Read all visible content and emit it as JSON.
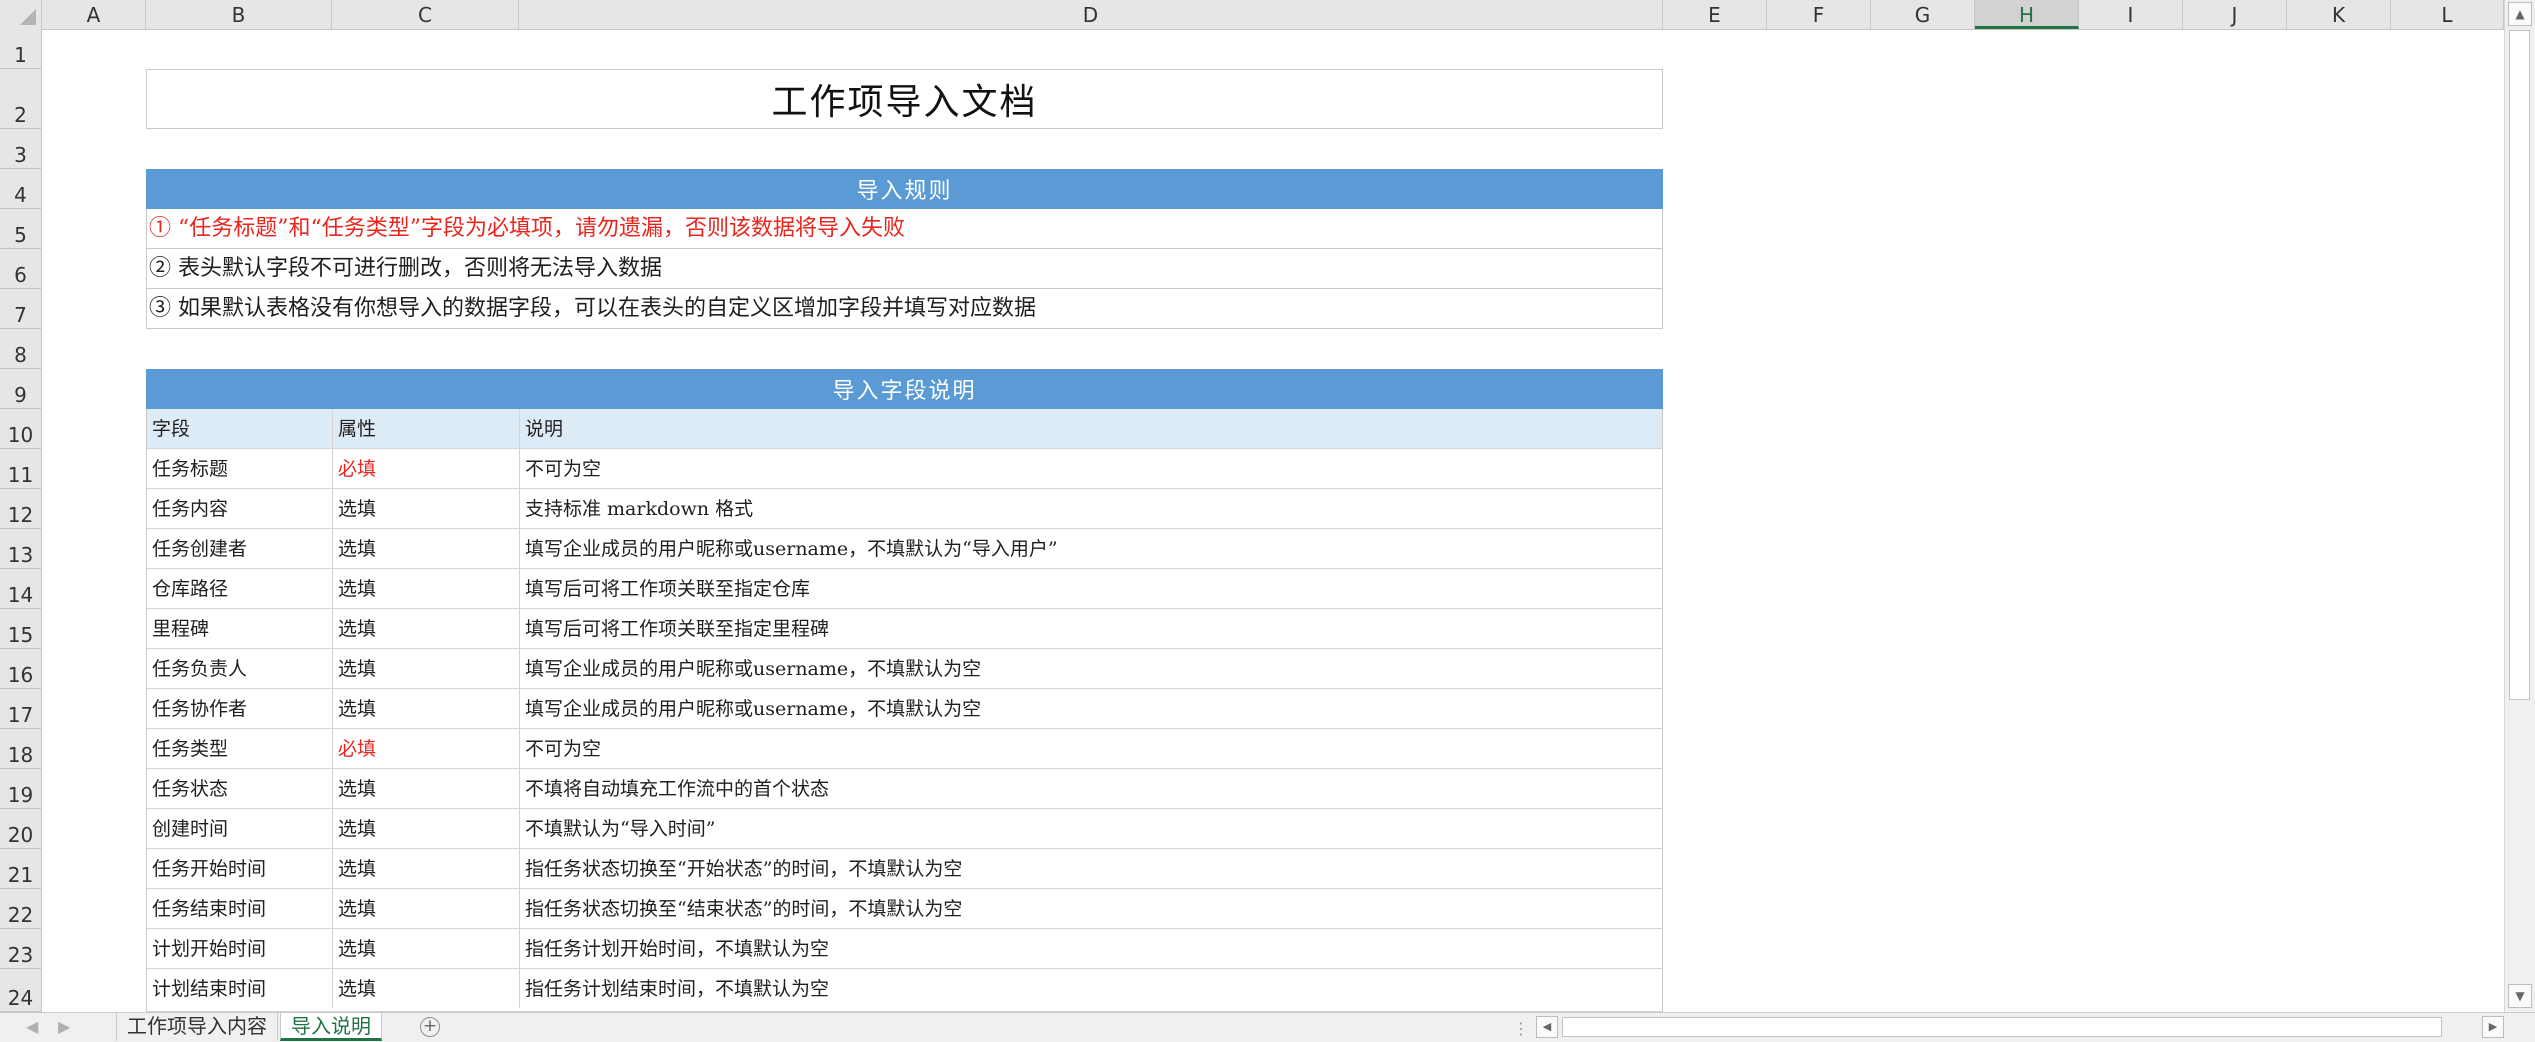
{
  "columns": [
    "A",
    "B",
    "C",
    "D",
    "E",
    "F",
    "G",
    "H",
    "I",
    "J",
    "K",
    "L"
  ],
  "selected_column": "H",
  "rows": [
    "1",
    "2",
    "3",
    "4",
    "5",
    "6",
    "7",
    "8",
    "9",
    "10",
    "11",
    "12",
    "13",
    "14",
    "15",
    "16",
    "17",
    "18",
    "19",
    "20",
    "21",
    "22",
    "23",
    "24"
  ],
  "sheet": {
    "title": "工作项导入文档",
    "rules_header": "导入规则",
    "rules": [
      "①  “任务标题”和“任务类型”字段为必填项，请勿遗漏，否则该数据将导入失败",
      "②  表头默认字段不可进行删改，否则将无法导入数据",
      "③  如果默认表格没有你想导入的数据字段，可以在表头的自定义区增加字段并填写对应数据"
    ],
    "fields_header": "导入字段说明",
    "table_header": [
      "字段",
      "属性",
      "说明"
    ],
    "fields": [
      {
        "name": "任务标题",
        "attr": "必填",
        "desc": "不可为空"
      },
      {
        "name": "任务内容",
        "attr": "选填",
        "desc": "支持标准 markdown 格式"
      },
      {
        "name": "任务创建者",
        "attr": "选填",
        "desc": "填写企业成员的用户昵称或username，不填默认为“导入用户”"
      },
      {
        "name": "仓库路径",
        "attr": "选填",
        "desc": "填写后可将工作项关联至指定仓库"
      },
      {
        "name": "里程碑",
        "attr": "选填",
        "desc": "填写后可将工作项关联至指定里程碑"
      },
      {
        "name": "任务负责人",
        "attr": "选填",
        "desc": "填写企业成员的用户昵称或username，不填默认为空"
      },
      {
        "name": "任务协作者",
        "attr": "选填",
        "desc": "填写企业成员的用户昵称或username，不填默认为空"
      },
      {
        "name": "任务类型",
        "attr": "必填",
        "desc": "不可为空"
      },
      {
        "name": "任务状态",
        "attr": "选填",
        "desc": "不填将自动填充工作流中的首个状态"
      },
      {
        "name": "创建时间",
        "attr": "选填",
        "desc": "不填默认为“导入时间”"
      },
      {
        "name": "任务开始时间",
        "attr": "选填",
        "desc": "指任务状态切换至“开始状态”的时间，不填默认为空"
      },
      {
        "name": "任务结束时间",
        "attr": "选填",
        "desc": "指任务状态切换至“结束状态”的时间，不填默认为空"
      },
      {
        "name": "计划开始时间",
        "attr": "选填",
        "desc": "指任务计划开始时间，不填默认为空"
      },
      {
        "name": "计划结束时间",
        "attr": "选填",
        "desc": "指任务计划结束时间，不填默认为空"
      }
    ]
  },
  "tabs": [
    {
      "label": "工作项导入内容",
      "active": false
    },
    {
      "label": "导入说明",
      "active": true
    }
  ],
  "colors": {
    "header_band": "#5b9bd5",
    "table_header_bg": "#ddebf7",
    "required_text": "#e8261e",
    "excel_green": "#217346"
  }
}
